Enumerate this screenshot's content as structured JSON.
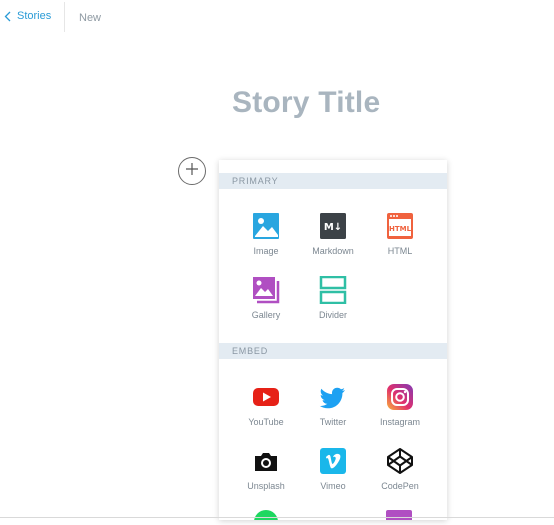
{
  "header": {
    "back_label": "Stories",
    "status": "New"
  },
  "story": {
    "title": "Story Title"
  },
  "inserter": {
    "primary_heading": "PRIMARY",
    "embed_heading": "EMBED",
    "primary": [
      {
        "label": "Image",
        "icon": "image-icon"
      },
      {
        "label": "Markdown",
        "icon": "markdown-icon"
      },
      {
        "label": "HTML",
        "icon": "html-icon"
      },
      {
        "label": "Gallery",
        "icon": "gallery-icon"
      },
      {
        "label": "Divider",
        "icon": "divider-icon"
      }
    ],
    "embed": [
      {
        "label": "YouTube",
        "icon": "youtube-icon"
      },
      {
        "label": "Twitter",
        "icon": "twitter-icon"
      },
      {
        "label": "Instagram",
        "icon": "instagram-icon"
      },
      {
        "label": "Unsplash",
        "icon": "unsplash-icon"
      },
      {
        "label": "Vimeo",
        "icon": "vimeo-icon"
      },
      {
        "label": "CodePen",
        "icon": "codepen-icon"
      }
    ]
  },
  "colors": {
    "accent": "#2a9bd6",
    "title": "#a9b5bf",
    "section_bg": "#e3ebf2"
  }
}
